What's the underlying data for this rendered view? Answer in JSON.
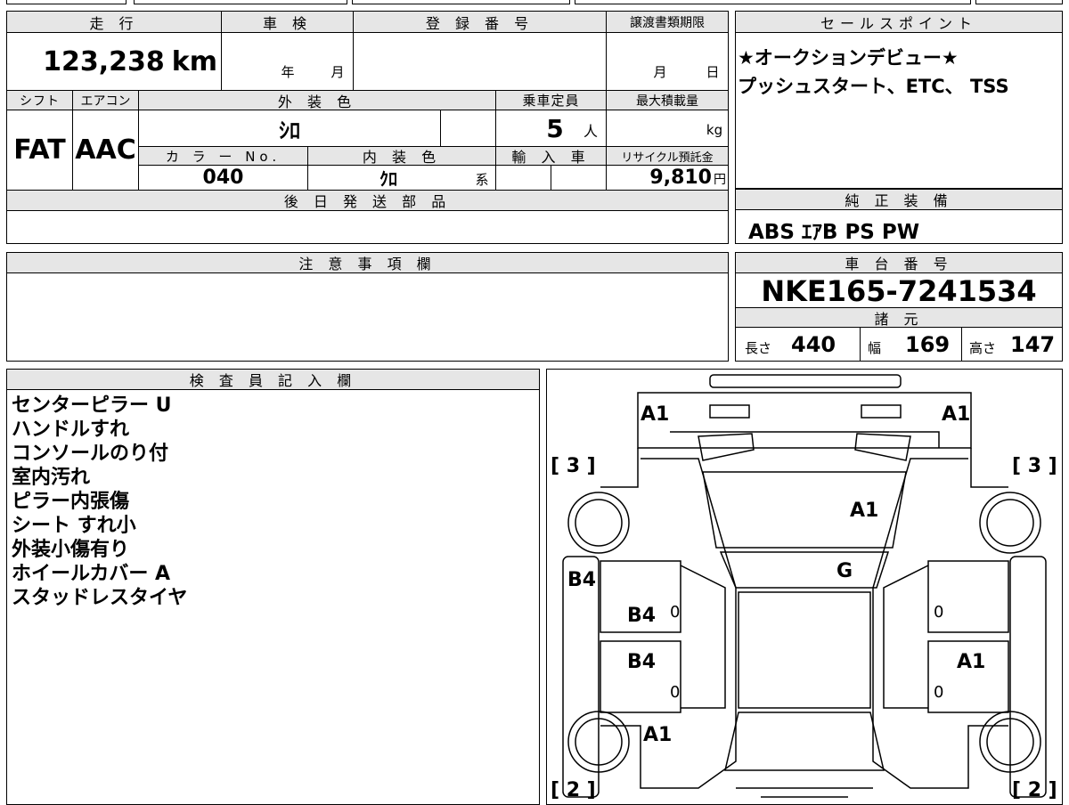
{
  "top_table": {
    "headers": {
      "mileage": "走 行",
      "inspection": "車 検",
      "registration": "登 録 番 号",
      "transfer_deadline": "譲渡書類期限",
      "shift": "シフト",
      "aircon": "エアコン",
      "exterior_color": "外 装 色",
      "capacity": "乗車定員",
      "max_load": "最大積載量",
      "color_no": "カ ラ ー No.",
      "interior_color": "内 装 色",
      "import": "輸 入 車",
      "recycle_fee": "リサイクル預託金",
      "later_parts": "後 日 発 送 部 品"
    },
    "mileage_value": "123,238",
    "mileage_unit": "km",
    "inspection_year": "年",
    "inspection_month": "月",
    "deadline_month": "月",
    "deadline_day": "日",
    "shift_value": "FAT",
    "aircon_value": "AAC",
    "exterior_color_value": "ｼﾛ",
    "capacity_value": "5",
    "capacity_unit": "人",
    "max_load_unit": "kg",
    "color_no_value": "040",
    "interior_color_value": "ｸﾛ",
    "interior_color_suffix": "系",
    "recycle_value": "9,810",
    "recycle_unit": "円"
  },
  "sales_points": {
    "header": "セールスポイント",
    "line1": "★オークションデビュー★",
    "line2": "プッシュスタート、ETC、 TSS"
  },
  "genuine_equipment": {
    "header": "純 正 装 備",
    "value": "ABS ｴｱB PS PW"
  },
  "notes_section": {
    "header": "注 意 事 項 欄"
  },
  "chassis": {
    "header": "車 台 番 号",
    "value": "NKE165-7241534"
  },
  "specs": {
    "header": "諸 元",
    "length_label": "長さ",
    "length_value": "440",
    "width_label": "幅",
    "width_value": "169",
    "height_label": "高さ",
    "height_value": "147"
  },
  "inspector": {
    "header": "検 査 員 記 入 欄",
    "lines": [
      "センターピラー U",
      "ハンドルすれ",
      "コンソールのり付",
      "室内汚れ",
      "ピラー内張傷",
      "シート すれ小",
      "外装小傷有り",
      "ホイールカバー A",
      "スタッドレスタイヤ"
    ]
  },
  "diagram": {
    "labels": {
      "front_left": "A1",
      "front_right": "A1",
      "tire_fl": "[ 3 ]",
      "tire_fr": "[ 3 ]",
      "hood": "A1",
      "windshield": "G",
      "left_fender": "B4",
      "left_front_door": "B4",
      "left_rear_door": "B4",
      "right_rear_door": "A1",
      "left_rear": "A1",
      "tire_rl": "[ 2 ]",
      "tire_rr": "[ 2 ]",
      "door_mark_lf": "0",
      "door_mark_lr": "0",
      "door_mark_rf": "0",
      "door_mark_rr": "0"
    }
  }
}
